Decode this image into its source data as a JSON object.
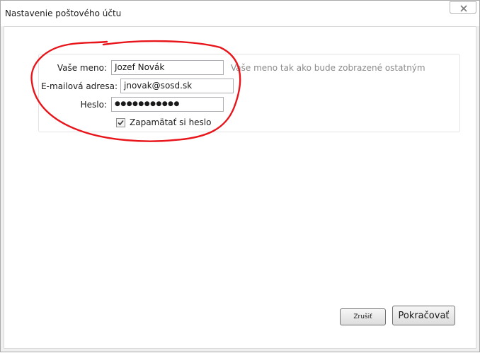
{
  "window": {
    "title": "Nastavenie poštového účtu"
  },
  "form": {
    "name": {
      "label": "Vaše meno:",
      "value": "Jozef Novák",
      "hint": "Vaše meno tak ako bude zobrazené ostatným"
    },
    "email": {
      "label": "E-mailová adresa:",
      "value": "jnovak@sosd.sk"
    },
    "password": {
      "label": "Heslo:",
      "value": "●●●●●●●●●●●"
    },
    "remember": {
      "label": "Zapamätať si heslo",
      "checked": true
    }
  },
  "buttons": {
    "cancel": "Zrušiť",
    "continue": "Pokračovať"
  },
  "colors": {
    "annotation": "#e8151b"
  }
}
